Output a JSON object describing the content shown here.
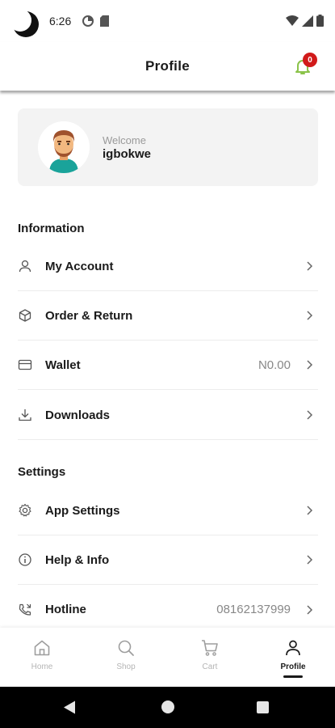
{
  "status_bar": {
    "time": "6:26"
  },
  "header": {
    "title": "Profile",
    "notification_count": "0"
  },
  "welcome": {
    "greeting": "Welcome",
    "username": "igbokwe"
  },
  "information": {
    "title": "Information",
    "items": [
      {
        "label": "My Account",
        "icon": "user-icon",
        "value": ""
      },
      {
        "label": "Order & Return",
        "icon": "box-icon",
        "value": ""
      },
      {
        "label": "Wallet",
        "icon": "wallet-icon",
        "value": "N0.00"
      },
      {
        "label": "Downloads",
        "icon": "download-icon",
        "value": ""
      }
    ]
  },
  "settings": {
    "title": "Settings",
    "items": [
      {
        "label": "App Settings",
        "icon": "gear-icon",
        "value": ""
      },
      {
        "label": "Help & Info",
        "icon": "info-icon",
        "value": ""
      },
      {
        "label": "Hotline",
        "icon": "phone-icon",
        "value": "08162137999"
      }
    ]
  },
  "bottom_nav": {
    "items": [
      {
        "label": "Home",
        "icon": "home-icon"
      },
      {
        "label": "Shop",
        "icon": "search-icon"
      },
      {
        "label": "Cart",
        "icon": "cart-icon"
      },
      {
        "label": "Profile",
        "icon": "profile-icon"
      }
    ],
    "active": "Profile"
  },
  "colors": {
    "accent": "#8bc34a",
    "badge": "#d11a1a",
    "card": "#f3f3f3"
  }
}
